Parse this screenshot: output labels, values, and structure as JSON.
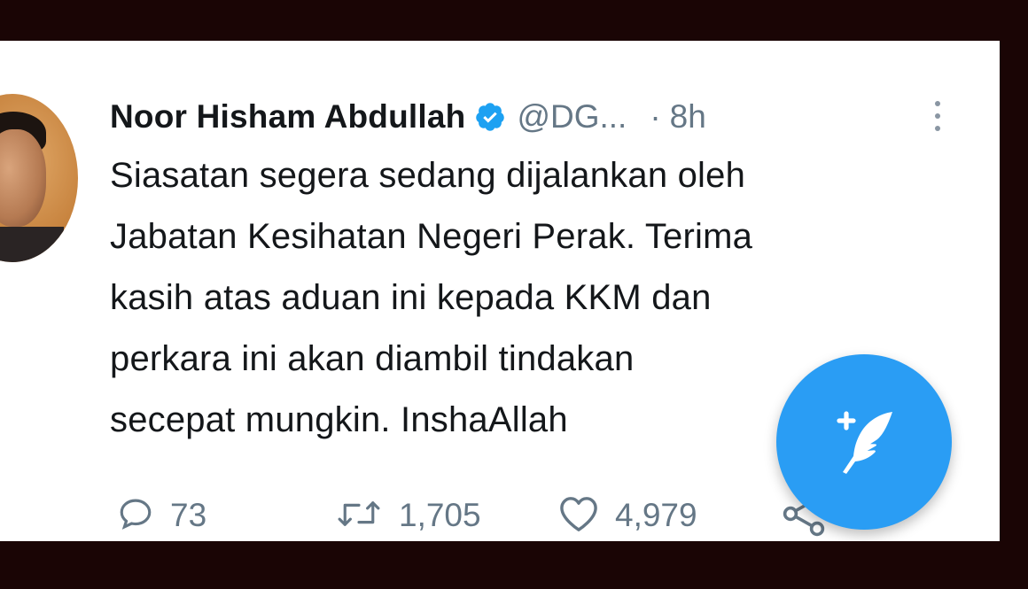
{
  "tweet": {
    "author_name": "Noor Hisham Abdullah",
    "handle": "@DG...",
    "separator": "·",
    "time": "8h",
    "text_lines": [
      "Siasatan segera sedang dijalankan oleh",
      "Jabatan Kesihatan Negeri Perak. Terima",
      "kasih atas aduan ini kepada KKM dan",
      "perkara ini akan diambil tindakan",
      "secepat mungkin. InshaAllah"
    ],
    "reply_count": "73",
    "retweet_count": "1,705",
    "like_count": "4,979"
  },
  "icons": {
    "verified": "verified-badge-icon",
    "more": "more-vertical-icon",
    "reply": "reply-icon",
    "retweet": "retweet-icon",
    "like": "heart-icon",
    "share": "share-icon",
    "compose": "compose-tweet-icon"
  },
  "colors": {
    "brand_blue": "#1da1f2",
    "fab_blue": "#2a9df4",
    "text_primary": "#14171a",
    "text_secondary": "#657786",
    "frame": "#1a0505"
  }
}
